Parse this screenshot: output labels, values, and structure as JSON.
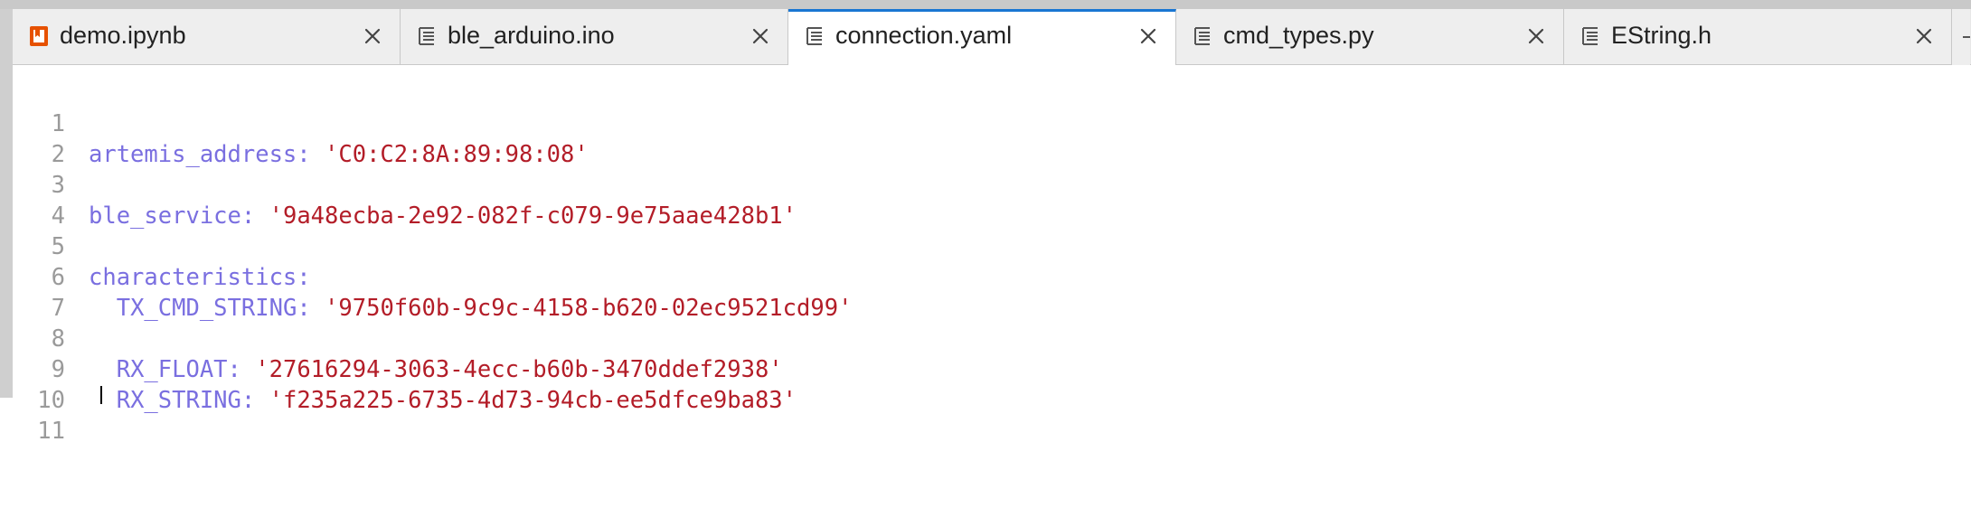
{
  "tabs": [
    {
      "label": "demo.ipynb",
      "icon": "notebook-icon",
      "active": false
    },
    {
      "label": "ble_arduino.ino",
      "icon": "text-file-icon",
      "active": false
    },
    {
      "label": "connection.yaml",
      "icon": "text-file-icon",
      "active": true
    },
    {
      "label": "cmd_types.py",
      "icon": "text-file-icon",
      "active": false
    },
    {
      "label": "EString.h",
      "icon": "text-file-icon",
      "active": false
    }
  ],
  "editor": {
    "lines": [
      {
        "num": "1",
        "indent": "",
        "key": "artemis_address",
        "sep": ": ",
        "value": "'C0:C2:8A:89:98:08'"
      },
      {
        "num": "2",
        "indent": "",
        "key": "",
        "sep": "",
        "value": ""
      },
      {
        "num": "3",
        "indent": "",
        "key": "ble_service",
        "sep": ": ",
        "value": "'9a48ecba-2e92-082f-c079-9e75aae428b1'"
      },
      {
        "num": "4",
        "indent": "",
        "key": "",
        "sep": "",
        "value": ""
      },
      {
        "num": "5",
        "indent": "",
        "key": "characteristics",
        "sep": ":",
        "value": ""
      },
      {
        "num": "6",
        "indent": "  ",
        "key": "TX_CMD_STRING",
        "sep": ": ",
        "value": "'9750f60b-9c9c-4158-b620-02ec9521cd99'"
      },
      {
        "num": "7",
        "indent": "",
        "key": "",
        "sep": "",
        "value": ""
      },
      {
        "num": "8",
        "indent": "  ",
        "key": "RX_FLOAT",
        "sep": ": ",
        "value": "'27616294-3063-4ecc-b60b-3470ddef2938'"
      },
      {
        "num": "9",
        "indent": "  ",
        "key": "RX_STRING",
        "sep": ": ",
        "value": "'f235a225-6735-4d73-94cb-ee5dfce9ba83'"
      },
      {
        "num": "10",
        "indent": "",
        "key": "",
        "sep": "",
        "value": ""
      },
      {
        "num": "11",
        "indent": "",
        "key": "",
        "sep": "",
        "value": ""
      }
    ]
  },
  "colors": {
    "accent": "#1976d2",
    "notebook_icon": "#e65100",
    "yaml_key": "#7a6fe0",
    "yaml_string": "#b31d28"
  }
}
